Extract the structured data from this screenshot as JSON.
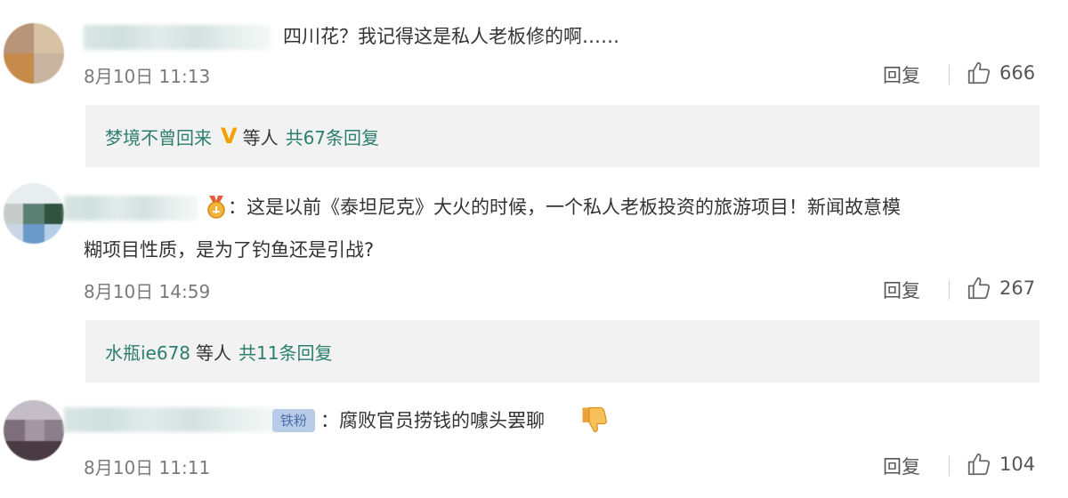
{
  "comments": [
    {
      "text": "四川花？我记得这是私人老板修的啊……",
      "time": "8月10日 11:13",
      "reply_label": "回复",
      "likes": "666",
      "replies": {
        "user": "梦境不曾回来",
        "verified_mark": "V",
        "etc": "等人",
        "count_label": "共67条回复"
      }
    },
    {
      "text_line1": "：这是以前《泰坦尼克》大火的时候，一个私人老板投资的旅游项目！新闻故意模",
      "text_line2": "糊项目性质，是为了钓鱼还是引战?",
      "time": "8月10日 14:59",
      "reply_label": "回复",
      "likes": "267",
      "replies": {
        "user": "水瓶ie678",
        "etc": "等人",
        "count_label": "共11条回复"
      }
    },
    {
      "badge": "铁粉",
      "text": "：腐败官员捞钱的噱头罢聊",
      "time": "8月10日 11:11",
      "reply_label": "回复",
      "likes": "104"
    }
  ],
  "colors": {
    "link": "#2c7f6f",
    "reply_bg": "#f2f2f2",
    "verified": "#f4a100"
  },
  "icons": {
    "like": "thumbs-up-icon",
    "dislike": "thumbs-down-icon",
    "medal": "medal-icon"
  }
}
